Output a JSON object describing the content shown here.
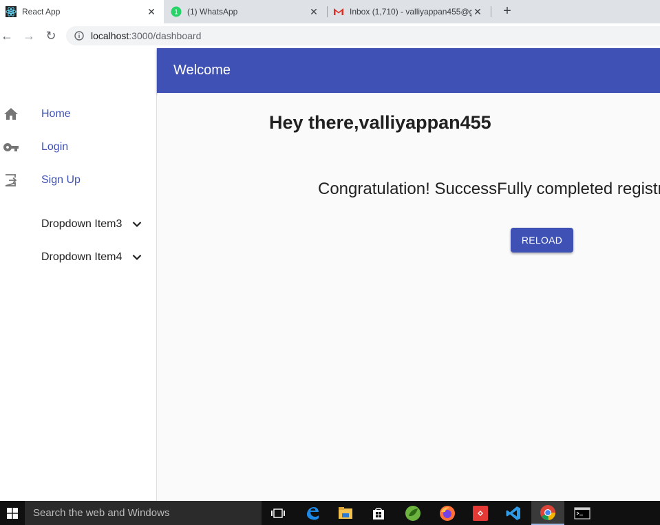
{
  "browser": {
    "tabs": [
      {
        "title": "React App",
        "active": true
      },
      {
        "title": "(1) WhatsApp",
        "active": false
      },
      {
        "title": "Inbox (1,710) - valliyappan455@g",
        "active": false
      }
    ],
    "close_glyph": "✕",
    "new_tab_glyph": "+",
    "nav": {
      "back": "←",
      "forward": "→",
      "reload": "↻"
    },
    "url_host": "localhost",
    "url_path": ":3000/dashboard"
  },
  "sidebar": {
    "items": [
      {
        "label": "Home",
        "icon": "home-icon"
      },
      {
        "label": "Login",
        "icon": "key-icon"
      },
      {
        "label": "Sign Up",
        "icon": "sign-in-icon"
      }
    ],
    "dropdowns": [
      {
        "label": "Dropdown Item3",
        "icon": "chevron-down-icon"
      },
      {
        "label": "Dropdown Item4",
        "icon": "chevron-down-icon"
      }
    ]
  },
  "appbar": {
    "title": "Welcome"
  },
  "main": {
    "greeting": "Hey there,valliyappan455",
    "message": "Congratulation! SuccessFully completed registr",
    "reload_label": "RELOAD"
  },
  "taskbar": {
    "search_placeholder": "Search the web and Windows",
    "apps": [
      "task-view-icon",
      "edge-icon",
      "file-explorer-icon",
      "store-icon",
      "spring-icon",
      "firefox-icon",
      "git-icon",
      "vscode-icon",
      "chrome-icon",
      "terminal-icon"
    ]
  },
  "colors": {
    "primary": "#3f51b5",
    "taskbar": "#101010"
  }
}
